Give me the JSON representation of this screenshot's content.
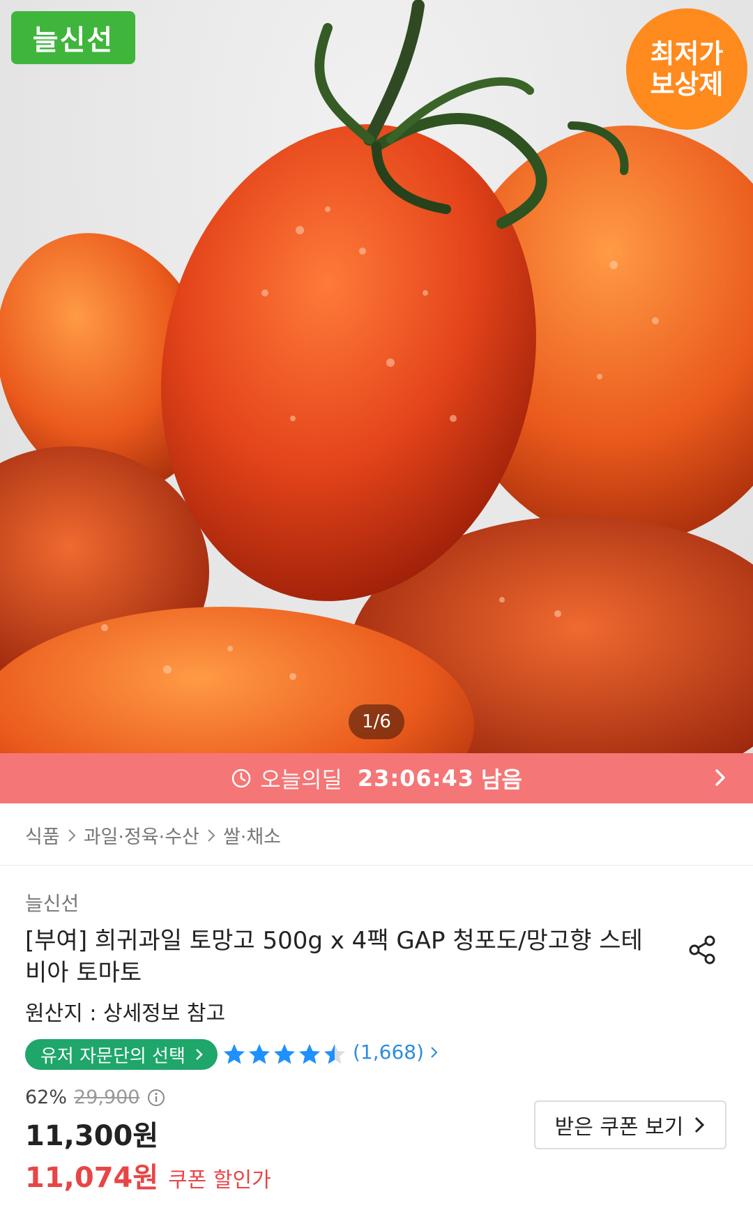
{
  "hero": {
    "badge_fresh": "늘신선",
    "badge_lowest_line1": "최저가",
    "badge_lowest_line2": "보상제",
    "image_counter": "1/6"
  },
  "deal_bar": {
    "label": "오늘의딜",
    "time": "23:06:43",
    "remain": "남음",
    "colors": {
      "background": "#f57676"
    }
  },
  "breadcrumb": [
    "식품",
    "과일·정육·수산",
    "쌀·채소"
  ],
  "product": {
    "brand": "늘신선",
    "title": "[부여] 희귀과일 토망고 500g x 4팩 GAP 청포도/망고향 스테비아 토마토",
    "origin": "원산지 : 상세정보 참고",
    "pick_badge": "유저 자문단의 선택",
    "rating": 4.5,
    "review_count": "(1,668)",
    "discount_rate": "62%",
    "original_price": "29,900",
    "price": "11,300원",
    "coupon_price": "11,074원",
    "coupon_price_label": "쿠폰 할인가",
    "coupon_button": "받은 쿠폰 보기"
  },
  "colors": {
    "fresh_green": "#3fb53c",
    "lowest_orange": "#ff8a1e",
    "pick_green": "#1fa66a",
    "star_blue": "#1e90ff",
    "coupon_red": "#e84545"
  }
}
